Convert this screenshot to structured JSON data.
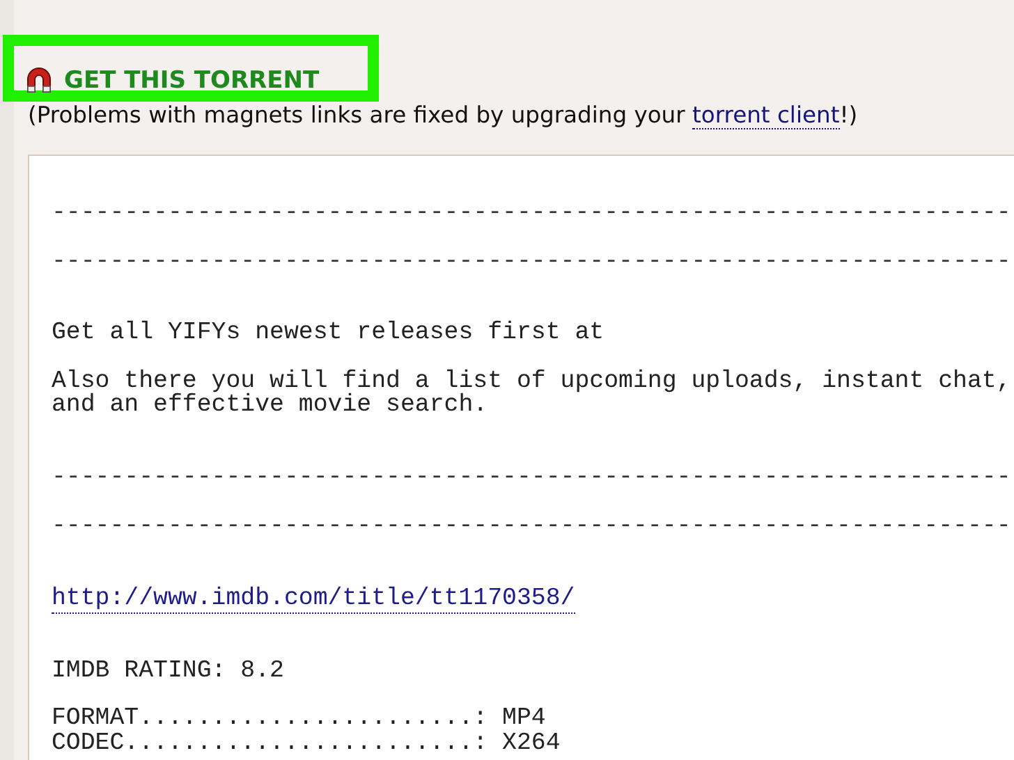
{
  "heading": {
    "label": "GET THIS TORRENT",
    "highlighted": true
  },
  "note": {
    "before": "(Problems with magnets links are fixed by upgrading your ",
    "link": "torrent client",
    "after": "!)"
  },
  "description": {
    "sections": [
      [
        [
          {
            "kind": "rule",
            "text": "------------------------------------------------------------------"
          }
        ],
        [
          {
            "kind": "rule",
            "text": "------------------------------------------------------------------"
          }
        ]
      ],
      [
        [
          {
            "kind": "text",
            "text": "Get all YIFYs newest releases first at"
          }
        ],
        [
          {
            "kind": "text",
            "text": "Also there you will find a list of upcoming uploads, instant chat,"
          },
          {
            "kind": "text",
            "text": "and an effective movie search."
          }
        ]
      ],
      [
        [
          {
            "kind": "rule",
            "text": "------------------------------------------------------------------"
          }
        ],
        [
          {
            "kind": "rule",
            "text": "------------------------------------------------------------------"
          }
        ]
      ],
      [
        [
          {
            "kind": "link",
            "text": "http://www.imdb.com/title/tt1170358/"
          }
        ]
      ],
      [
        [
          {
            "kind": "text",
            "text": "IMDB RATING: 8.2"
          }
        ],
        [
          {
            "kind": "text",
            "text": "FORMAT.......................: MP4"
          },
          {
            "kind": "text",
            "text": "CODEC........................: X264"
          }
        ]
      ]
    ]
  }
}
